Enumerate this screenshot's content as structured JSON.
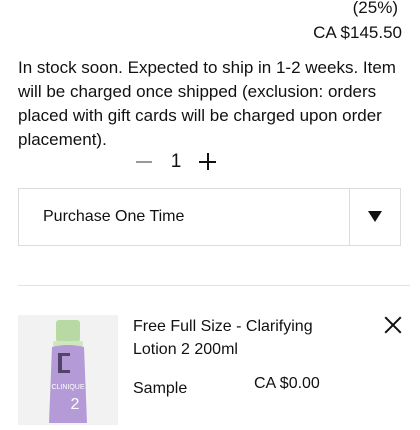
{
  "pricing": {
    "discount": "(25%)",
    "price": "CA $145.50"
  },
  "stock_message": "In stock soon. Expected to ship in 1-2 weeks. Item will be charged once shipped (exclusion: orders placed with gift cards will be charged upon order placement).",
  "quantity": {
    "value": "1",
    "decrement_icon": "minus-icon",
    "increment_icon": "plus-icon"
  },
  "purchase_select": {
    "selected": "Purchase One Time",
    "icon": "dropdown-arrow-icon"
  },
  "free_item": {
    "title": "Free Full Size - Clarifying Lotion 2 200ml",
    "type_label": "Sample",
    "price": "CA $0.00",
    "remove_icon": "close-icon",
    "product_label": "CLINIQUE",
    "product_number": "2"
  },
  "colors": {
    "accent_cap": "#b9d9a4",
    "liquid": "#b49ad6"
  }
}
